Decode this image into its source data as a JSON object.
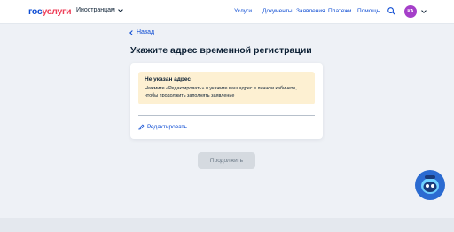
{
  "header": {
    "logo_part1": "гос",
    "logo_part2": "услуги",
    "role": "Иностранцам",
    "nav": [
      "Услуги",
      "Документы",
      "Заявления",
      "Платежи",
      "Помощь"
    ],
    "avatar_initials": "КА"
  },
  "page": {
    "back": "Назад",
    "title": "Укажите адрес временной регистрации"
  },
  "alert": {
    "title": "Не указан адрес",
    "text_line1": "Нажмите «Редактировать» и укажите ваш адрес в личном кабинете,",
    "text_line2": "чтобы продолжить заполнять заявление"
  },
  "actions": {
    "edit": "Редактировать",
    "continue": "Продолжить"
  },
  "colors": {
    "brand_blue": "#0d4cd3",
    "brand_red": "#ee3f58",
    "alert_bg": "#fdf0d2",
    "avatar": "#a53fc9"
  },
  "icons": [
    "chevron-down-icon",
    "search-icon",
    "back-arrow-icon",
    "pencil-icon",
    "robot-assistant-icon"
  ]
}
